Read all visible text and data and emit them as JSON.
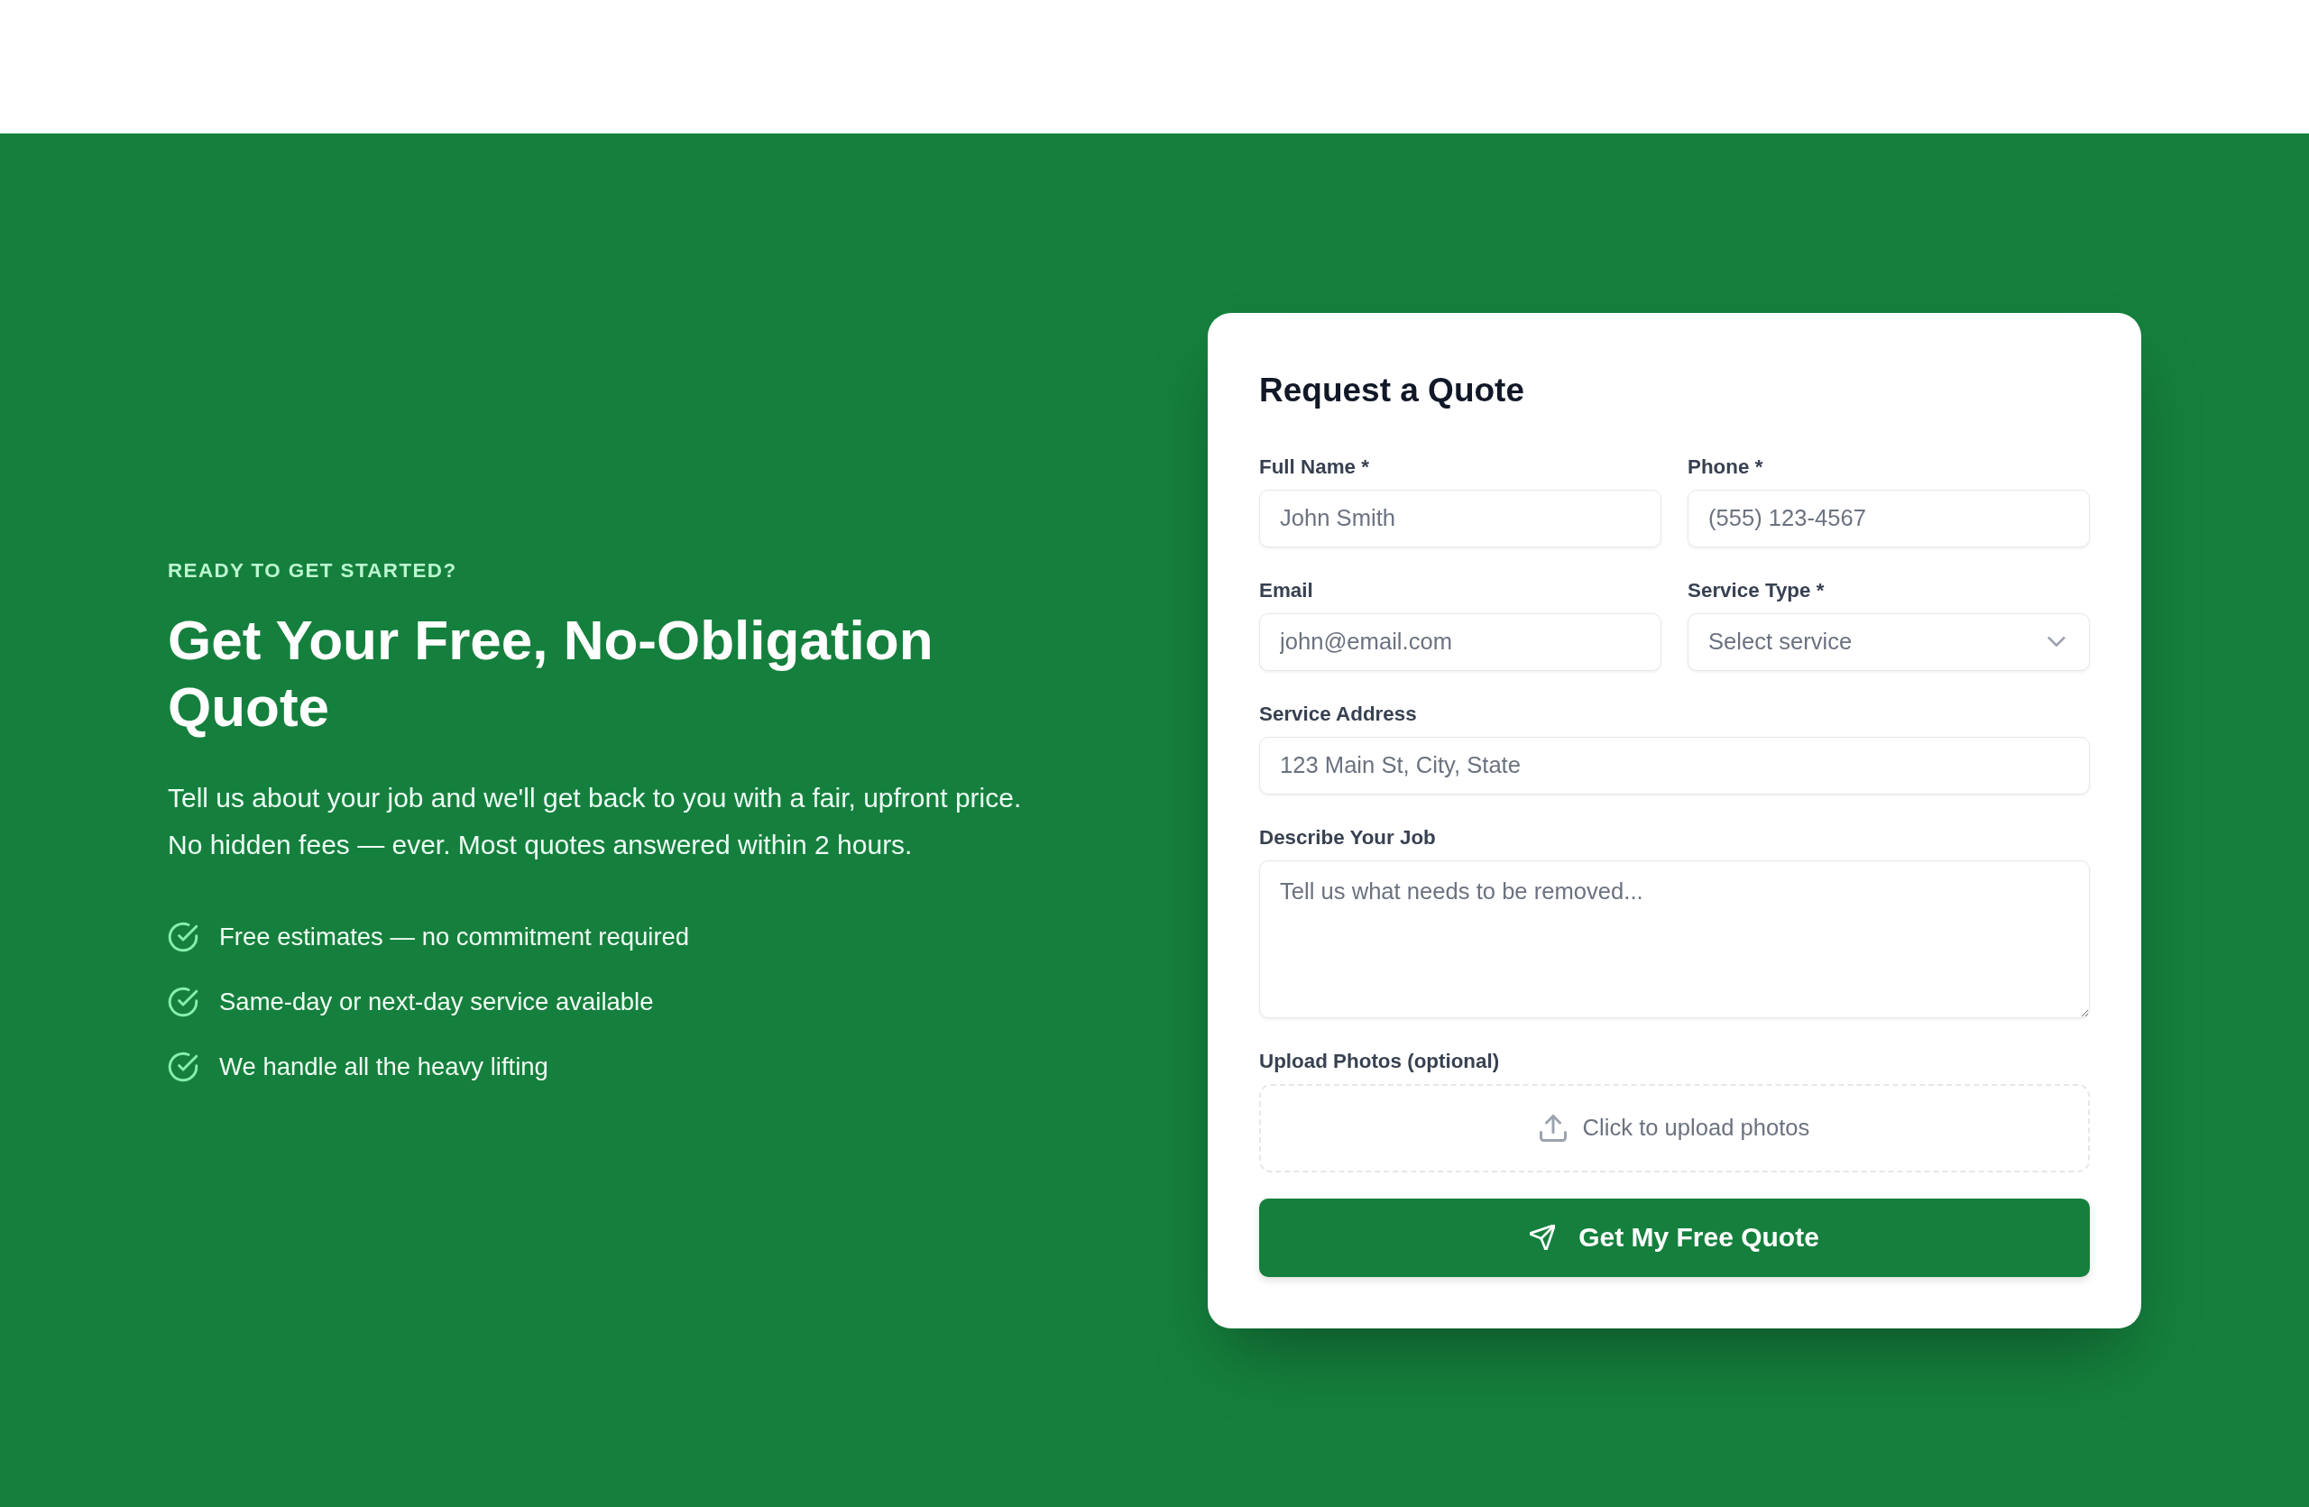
{
  "intro": {
    "eyebrow": "READY TO GET STARTED?",
    "heading": "Get Your Free, No-Obligation Quote",
    "description": "Tell us about your job and we'll get back to you with a fair, upfront price. No hidden fees — ever. Most quotes answered within 2 hours.",
    "benefits": [
      "Free estimates — no commitment required",
      "Same-day or next-day service available",
      "We handle all the heavy lifting"
    ]
  },
  "quote_form": {
    "title": "Request a Quote",
    "rows": [
      [
        {
          "kind": "text",
          "label": "Full Name *",
          "placeholder": "John Smith"
        },
        {
          "kind": "text",
          "label": "Phone *",
          "placeholder": "(555) 123-4567"
        }
      ],
      [
        {
          "kind": "text",
          "label": "Email",
          "placeholder": "john@email.com"
        },
        {
          "kind": "select",
          "label": "Service Type *",
          "placeholder": "Select service"
        }
      ],
      [
        {
          "kind": "text",
          "label": "Service Address",
          "placeholder": "123 Main St, City, State"
        }
      ],
      [
        {
          "kind": "textarea",
          "label": "Describe Your Job",
          "placeholder": "Tell us what needs to be removed..."
        }
      ],
      [
        {
          "kind": "upload",
          "label": "Upload Photos (optional)",
          "placeholder": "Click to upload photos"
        }
      ]
    ],
    "submit_button": "Get My Free Quote"
  }
}
